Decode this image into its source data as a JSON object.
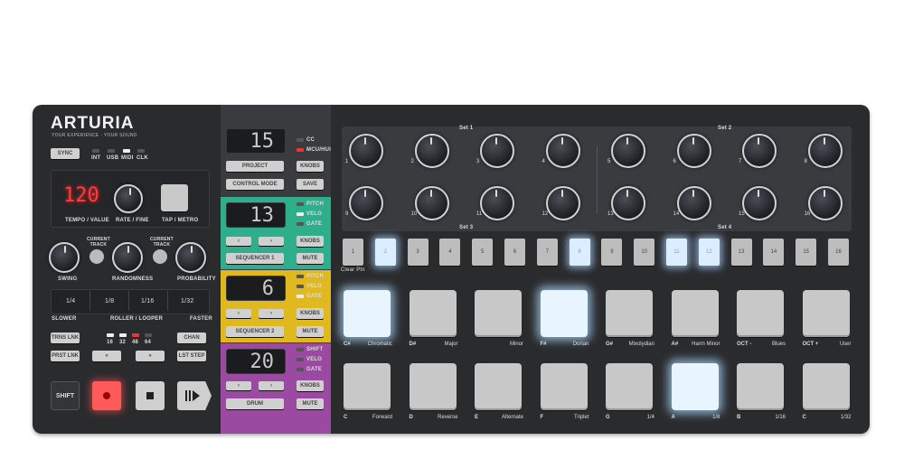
{
  "brand": {
    "name": "ARTURIA",
    "tagline": "YOUR EXPERIENCE · YOUR SOUND"
  },
  "sync": {
    "button": "SYNC",
    "leds": [
      "INT",
      "USB",
      "MIDI",
      "CLK"
    ]
  },
  "tempo": {
    "display": "120",
    "tempo_label": "TEMPO / VALUE",
    "rate_label": "RATE / FINE",
    "tap_label": "TAP / METRO"
  },
  "knobs_left": {
    "swing": "SWING",
    "randomness": "RANDOMNESS",
    "probability": "PROBABILITY",
    "current_track": "CURRENT\nTRACK"
  },
  "roller": {
    "values": [
      "1/4",
      "1/8",
      "1/16",
      "1/32"
    ],
    "slower": "SLOWER",
    "label": "ROLLER / LOOPER",
    "faster": "FASTER"
  },
  "links": {
    "trns_lnk": "TRNS LNK",
    "prst_lnk": "PRST LNK",
    "chan": "CHAN",
    "lst_step": "LST STEP",
    "lengths": [
      "16",
      "32",
      "48",
      "64"
    ],
    "prev": "«",
    "next": "»"
  },
  "transport": {
    "shift": "SHIFT"
  },
  "top_section": {
    "display": "15",
    "project": "PROJECT",
    "control_mode": "CONTROL MODE",
    "knobs": "KNOBS",
    "save": "SAVE",
    "leds": [
      "CC",
      "MCU/HUI"
    ]
  },
  "seq1": {
    "display": "13",
    "name": "SEQUENCER 1",
    "knobs": "KNOBS",
    "mute": "MUTE",
    "leds": [
      "PITCH",
      "VELO",
      "GATE"
    ],
    "color": "#2fae8c"
  },
  "seq2": {
    "display": "6",
    "name": "SEQUENCER 2",
    "knobs": "KNOBS",
    "mute": "MUTE",
    "leds": [
      "PITCH",
      "VELO",
      "GATE"
    ],
    "color": "#e0b820"
  },
  "drum": {
    "display": "20",
    "name": "DRUM",
    "knobs": "KNOBS",
    "mute": "MUTE",
    "leds": [
      "SHIFT",
      "VELO",
      "GATE"
    ],
    "color": "#9a4aa0"
  },
  "sets": {
    "set1": "Set 1",
    "set2": "Set 2",
    "set3": "Set 3",
    "set4": "Set 4"
  },
  "encoders": [
    "1",
    "2",
    "3",
    "4",
    "5",
    "6",
    "7",
    "8",
    "9",
    "10",
    "11",
    "12",
    "13",
    "14",
    "15",
    "16"
  ],
  "steps": {
    "labels": [
      "1",
      "2",
      "3",
      "4",
      "5",
      "6",
      "7",
      "8",
      "9",
      "10",
      "11",
      "12",
      "13",
      "14",
      "15",
      "16"
    ],
    "lit": [
      2,
      8,
      11,
      12
    ],
    "clear": "Clear Ptn"
  },
  "pads_top": [
    {
      "note": "C#",
      "mode": "Chromatic",
      "lit": true
    },
    {
      "note": "D#",
      "mode": "Major",
      "lit": false
    },
    {
      "note": "",
      "mode": "Minor",
      "lit": false
    },
    {
      "note": "F#",
      "mode": "Dorian",
      "lit": true
    },
    {
      "note": "G#",
      "mode": "Mixolydian",
      "lit": false
    },
    {
      "note": "A#",
      "mode": "Harm Minor",
      "lit": false
    },
    {
      "note": "OCT -",
      "mode": "Blues",
      "lit": false
    },
    {
      "note": "OCT +",
      "mode": "User",
      "lit": false
    }
  ],
  "pads_bottom": [
    {
      "note": "C",
      "mode": "Forward",
      "lit": false
    },
    {
      "note": "D",
      "mode": "Reverse",
      "lit": false
    },
    {
      "note": "E",
      "mode": "Alternate",
      "lit": false
    },
    {
      "note": "F",
      "mode": "Triplet",
      "lit": false
    },
    {
      "note": "G",
      "mode": "1/4",
      "lit": false
    },
    {
      "note": "A",
      "mode": "1/8",
      "lit": true
    },
    {
      "note": "B",
      "mode": "1/16",
      "lit": false
    },
    {
      "note": "C",
      "mode": "1/32",
      "lit": false
    }
  ]
}
